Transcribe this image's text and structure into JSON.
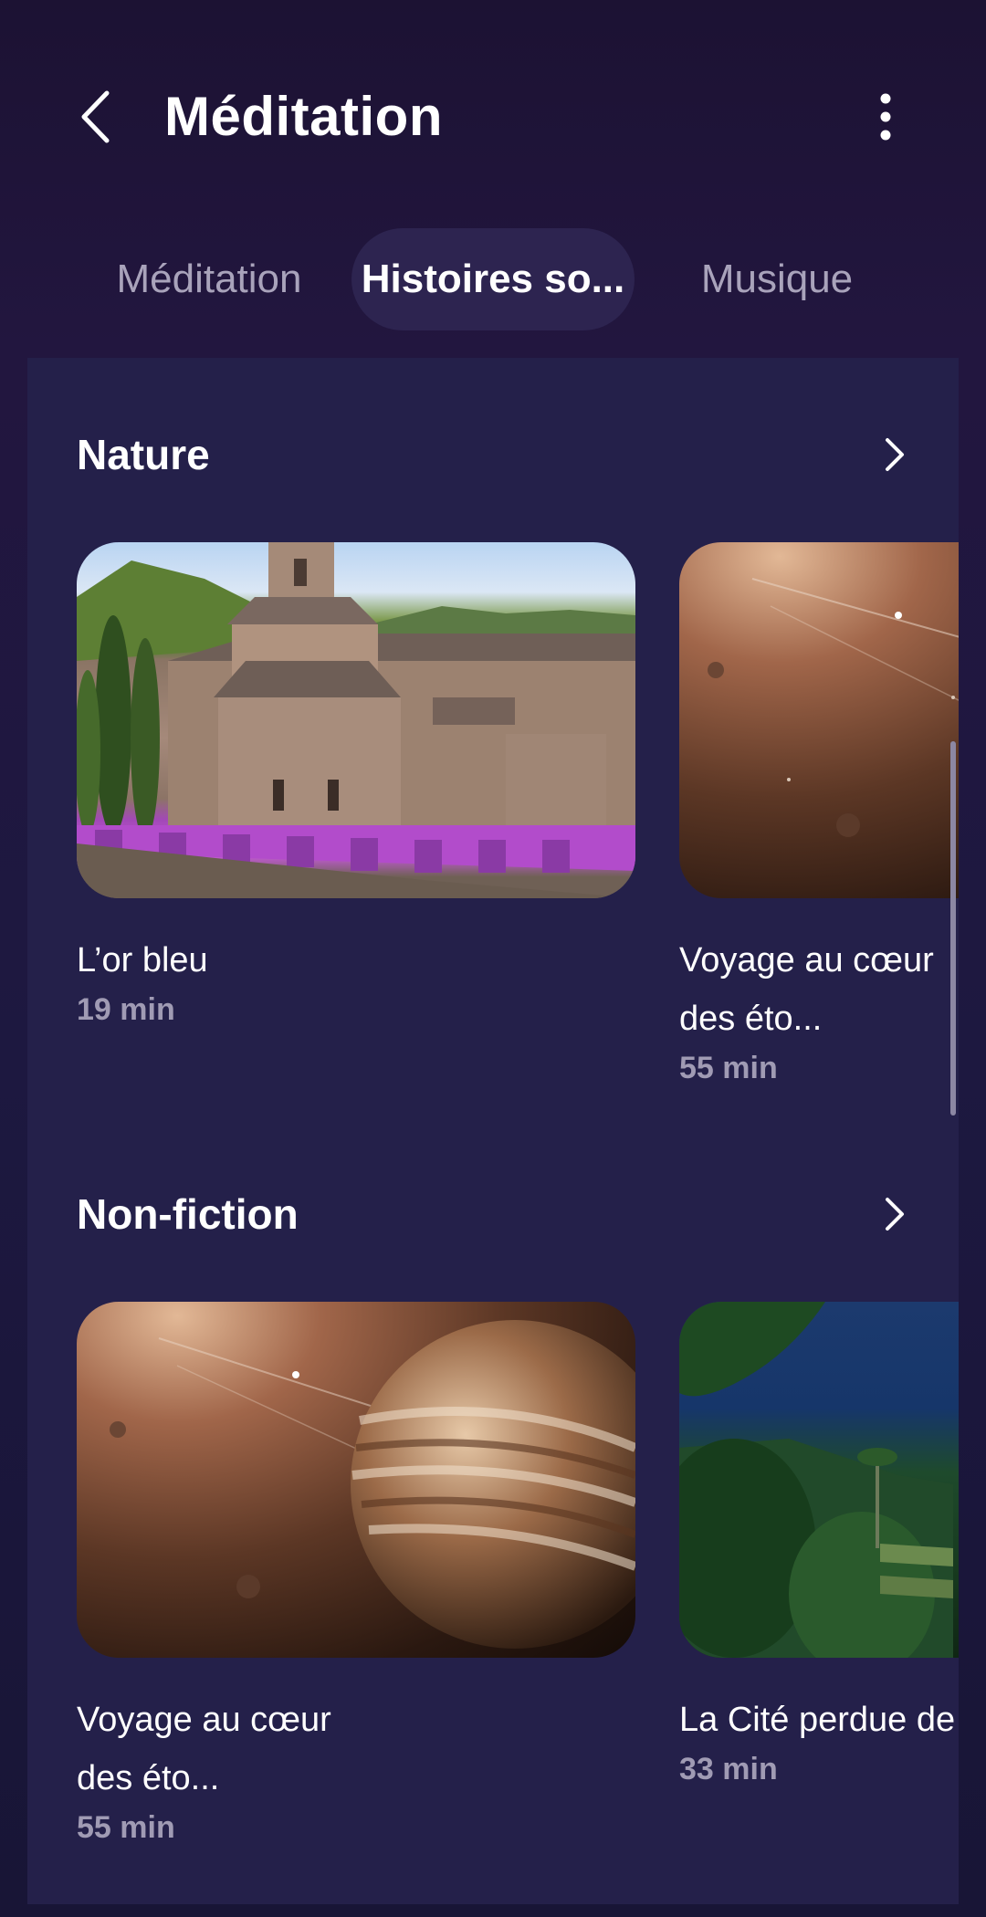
{
  "header": {
    "title": "Méditation",
    "back_icon": "chevron-left-icon",
    "more_icon": "more-vertical-icon"
  },
  "tabs": [
    {
      "label": "Méditation",
      "selected": false
    },
    {
      "label": "Histoires so...",
      "selected": true
    },
    {
      "label": "Musique",
      "selected": false
    }
  ],
  "sections": [
    {
      "title": "Nature",
      "chevron_icon": "chevron-right-icon",
      "cards": [
        {
          "title": "L’or bleu",
          "duration": "19 min",
          "image": "lavender-field-abbey"
        },
        {
          "title": "Voyage au cœur des éto...",
          "duration": "55 min",
          "image": "space-jupiter"
        }
      ]
    },
    {
      "title": "Non-fiction",
      "chevron_icon": "chevron-right-icon",
      "cards": [
        {
          "title": "Voyage au cœur des éto...",
          "duration": "55 min",
          "image": "space-jupiter"
        },
        {
          "title": "La Cité perdue de Colombie",
          "duration": "33 min",
          "image": "jungle-ruins-night"
        }
      ]
    }
  ],
  "colors": {
    "background": "#1c1233",
    "panel": "#24204a",
    "selected_tab": "#2d2450",
    "muted_text": "#a09bb4"
  }
}
